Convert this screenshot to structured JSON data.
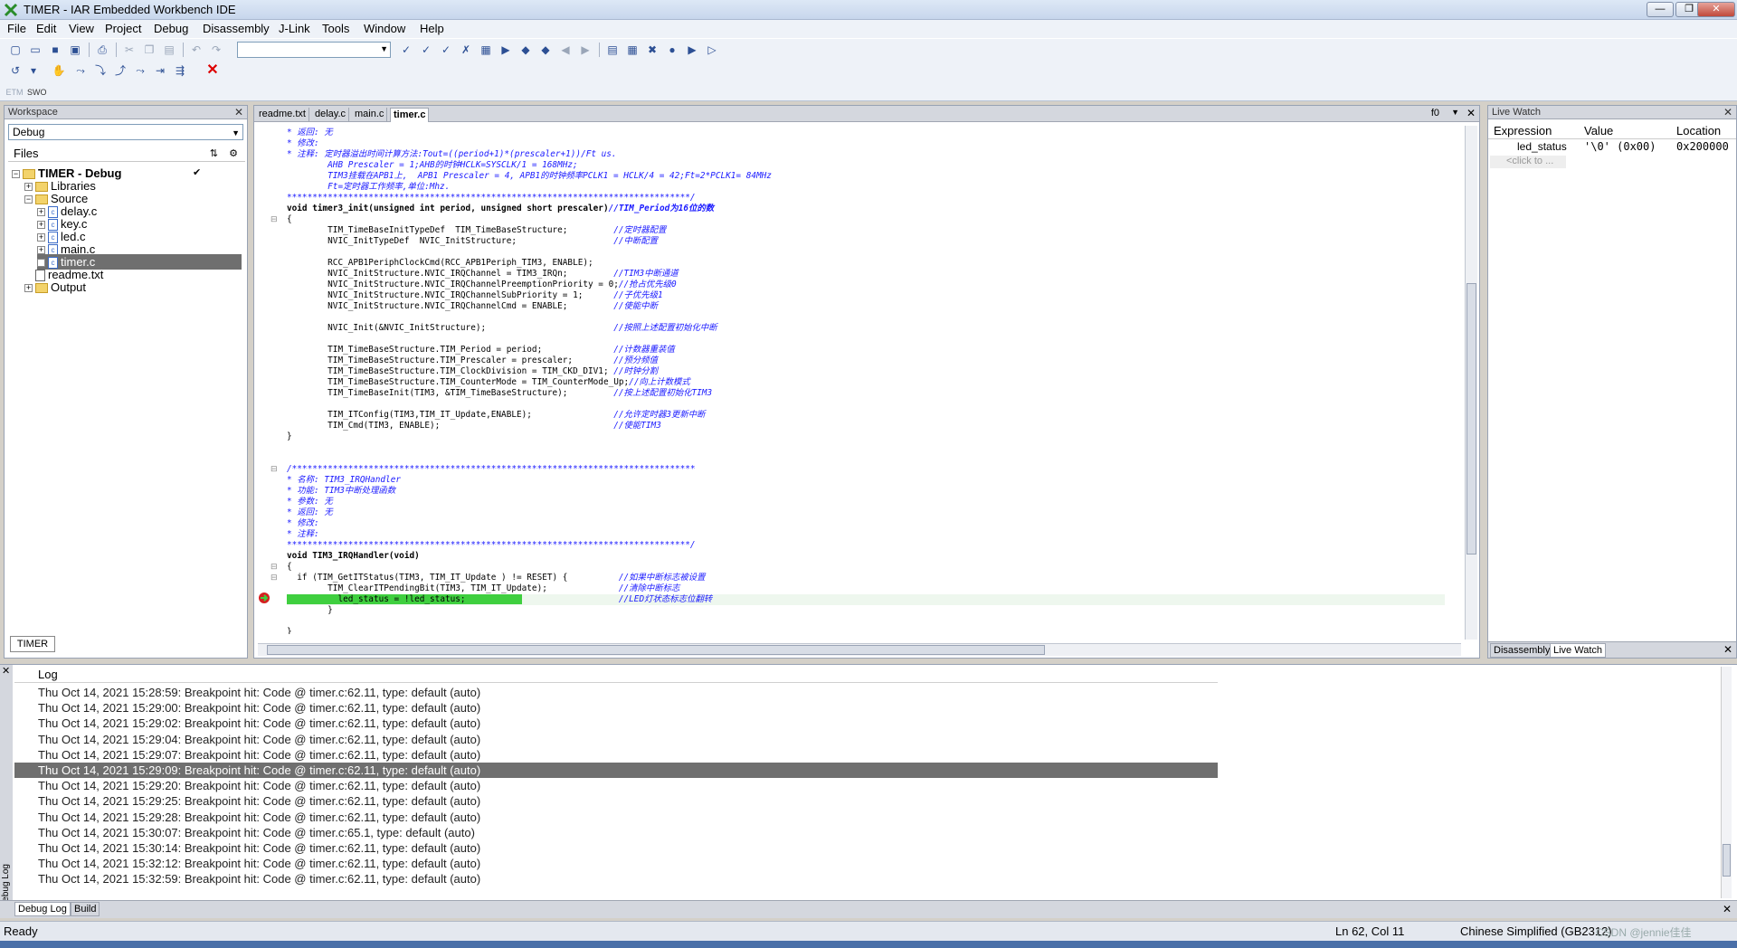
{
  "window": {
    "title": "TIMER - IAR Embedded Workbench IDE",
    "buttons": [
      "—",
      "❐",
      "✕"
    ]
  },
  "menu": [
    "File",
    "Edit",
    "View",
    "Project",
    "Debug",
    "Disassembly",
    "J-Link",
    "Tools",
    "Window",
    "Help"
  ],
  "toolbar3": {
    "etm_label": "ETM",
    "swo_label": "SWO"
  },
  "workspace": {
    "title": "Workspace",
    "config": "Debug",
    "files_header": "Files",
    "tree": [
      {
        "label": "TIMER - Debug",
        "level": 0,
        "type": "project",
        "expander": "−",
        "check": "✔"
      },
      {
        "label": "Libraries",
        "level": 1,
        "type": "folder",
        "expander": "+"
      },
      {
        "label": "Source",
        "level": 1,
        "type": "folder",
        "expander": "−"
      },
      {
        "label": "delay.c",
        "level": 2,
        "type": "c",
        "expander": "+"
      },
      {
        "label": "key.c",
        "level": 2,
        "type": "c",
        "expander": "+"
      },
      {
        "label": "led.c",
        "level": 2,
        "type": "c",
        "expander": "+"
      },
      {
        "label": "main.c",
        "level": 2,
        "type": "c",
        "expander": "+"
      },
      {
        "label": "timer.c",
        "level": 2,
        "type": "c",
        "expander": "+",
        "selected": true
      },
      {
        "label": "readme.txt",
        "level": 1,
        "type": "txt",
        "expander": ""
      },
      {
        "label": "Output",
        "level": 1,
        "type": "folder",
        "expander": "+"
      }
    ],
    "bottom_tab": "TIMER"
  },
  "editor": {
    "tabs": [
      "readme.txt",
      "delay.c",
      "main.c",
      "timer.c"
    ],
    "active_tab": "timer.c",
    "function_label": "f0",
    "lines": [
      {
        "t": "* 返回: 无",
        "c": "cm"
      },
      {
        "t": "* 修改:",
        "c": "cm"
      },
      {
        "t": "* 注释: 定时器溢出时间计算方法:Tout=((period+1)*(prescaler+1))/Ft us.",
        "c": "cm"
      },
      {
        "t": "        AHB Prescaler = 1;AHB的时钟HCLK=SYSCLK/1 = 168MHz;",
        "c": "cm"
      },
      {
        "t": "        TIM3挂载在APB1上,  APB1 Prescaler = 4, APB1的时钟频率PCLK1 = HCLK/4 = 42;Ft=2*PCLK1= 84MHz",
        "c": "cm"
      },
      {
        "t": "        Ft=定时器工作频率,单位:Mhz.",
        "c": "cm"
      },
      {
        "t": "*******************************************************************************/",
        "c": "cm"
      },
      {
        "t": "void timer3_init(unsigned int period, unsigned short prescaler)//TIM_Period为16位的数",
        "c": "fn"
      },
      {
        "t": "{",
        "c": ""
      },
      {
        "t": "        TIM_TimeBaseInitTypeDef  TIM_TimeBaseStructure;         //定时器配置",
        "c": "mix"
      },
      {
        "t": "        NVIC_InitTypeDef  NVIC_InitStructure;                   //中断配置",
        "c": "mix"
      },
      {
        "t": "",
        "c": ""
      },
      {
        "t": "        RCC_APB1PeriphClockCmd(RCC_APB1Periph_TIM3, ENABLE);",
        "c": ""
      },
      {
        "t": "        NVIC_InitStructure.NVIC_IRQChannel = TIM3_IRQn;         //TIM3中断通道",
        "c": "mix"
      },
      {
        "t": "        NVIC_InitStructure.NVIC_IRQChannelPreemptionPriority = 0;//抢占优先级0",
        "c": "mix"
      },
      {
        "t": "        NVIC_InitStructure.NVIC_IRQChannelSubPriority = 1;      //子优先级1",
        "c": "mix"
      },
      {
        "t": "        NVIC_InitStructure.NVIC_IRQChannelCmd = ENABLE;         //使能中断",
        "c": "mix"
      },
      {
        "t": "",
        "c": ""
      },
      {
        "t": "        NVIC_Init(&NVIC_InitStructure);                         //按照上述配置初始化中断",
        "c": "mix"
      },
      {
        "t": "",
        "c": ""
      },
      {
        "t": "        TIM_TimeBaseStructure.TIM_Period = period;              //计数器重装值",
        "c": "mix"
      },
      {
        "t": "        TIM_TimeBaseStructure.TIM_Prescaler = prescaler;        //预分频值",
        "c": "mix"
      },
      {
        "t": "        TIM_TimeBaseStructure.TIM_ClockDivision = TIM_CKD_DIV1; //时钟分割",
        "c": "mix"
      },
      {
        "t": "        TIM_TimeBaseStructure.TIM_CounterMode = TIM_CounterMode_Up;//向上计数模式",
        "c": "mix"
      },
      {
        "t": "        TIM_TimeBaseInit(TIM3, &TIM_TimeBaseStructure);         //按上述配置初始化TIM3",
        "c": "mix"
      },
      {
        "t": "",
        "c": ""
      },
      {
        "t": "        TIM_ITConfig(TIM3,TIM_IT_Update,ENABLE);                //允许定时器3更新中断",
        "c": "mix"
      },
      {
        "t": "        TIM_Cmd(TIM3, ENABLE);                                  //使能TIM3",
        "c": "mix"
      },
      {
        "t": "}",
        "c": ""
      },
      {
        "t": "",
        "c": ""
      },
      {
        "t": "",
        "c": ""
      },
      {
        "t": "/*******************************************************************************",
        "c": "cm"
      },
      {
        "t": "* 名称: TIM3_IRQHandler",
        "c": "cm"
      },
      {
        "t": "* 功能: TIM3中断处理函数",
        "c": "cm"
      },
      {
        "t": "* 参数: 无",
        "c": "cm"
      },
      {
        "t": "* 返回: 无",
        "c": "cm"
      },
      {
        "t": "* 修改:",
        "c": "cm"
      },
      {
        "t": "* 注释:",
        "c": "cm"
      },
      {
        "t": "*******************************************************************************/",
        "c": "cm"
      },
      {
        "t": "void TIM3_IRQHandler(void)",
        "c": "fn"
      },
      {
        "t": "{",
        "c": ""
      },
      {
        "t": "  if (TIM_GetITStatus(TIM3, TIM_IT_Update ) != RESET) {          //如果中断标志被设置",
        "c": "mix"
      },
      {
        "t": "        TIM_ClearITPendingBit(TIM3, TIM_IT_Update);              //清除中断标志",
        "c": "mix"
      },
      {
        "t": "          led_status = !led_status;                              //LED灯状态标志位翻转",
        "c": "hl"
      },
      {
        "t": "        }",
        "c": ""
      },
      {
        "t": "",
        "c": ""
      },
      {
        "t": "}",
        "c": ""
      }
    ]
  },
  "live_watch": {
    "title": "Live Watch",
    "columns": [
      "Expression",
      "Value",
      "Location"
    ],
    "rows": [
      {
        "expression": "led_status",
        "value": "'\\0' (0x00)",
        "location": "0x200000"
      }
    ],
    "placeholder": "<click to ...",
    "bottom_tabs": [
      "Disassembly",
      "Live Watch"
    ]
  },
  "log": {
    "header": "Log",
    "side_label": "Debug Log",
    "rows": [
      "Thu Oct 14, 2021 15:28:59: Breakpoint hit: Code @ timer.c:62.11, type: default (auto)",
      "Thu Oct 14, 2021 15:29:00: Breakpoint hit: Code @ timer.c:62.11, type: default (auto)",
      "Thu Oct 14, 2021 15:29:02: Breakpoint hit: Code @ timer.c:62.11, type: default (auto)",
      "Thu Oct 14, 2021 15:29:04: Breakpoint hit: Code @ timer.c:62.11, type: default (auto)",
      "Thu Oct 14, 2021 15:29:07: Breakpoint hit: Code @ timer.c:62.11, type: default (auto)",
      "Thu Oct 14, 2021 15:29:09: Breakpoint hit: Code @ timer.c:62.11, type: default (auto)",
      "Thu Oct 14, 2021 15:29:20: Breakpoint hit: Code @ timer.c:62.11, type: default (auto)",
      "Thu Oct 14, 2021 15:29:25: Breakpoint hit: Code @ timer.c:62.11, type: default (auto)",
      "Thu Oct 14, 2021 15:29:28: Breakpoint hit: Code @ timer.c:62.11, type: default (auto)",
      "Thu Oct 14, 2021 15:30:07: Breakpoint hit: Code @ timer.c:65.1, type: default (auto)",
      "Thu Oct 14, 2021 15:30:14: Breakpoint hit: Code @ timer.c:62.11, type: default (auto)",
      "Thu Oct 14, 2021 15:32:12: Breakpoint hit: Code @ timer.c:62.11, type: default (auto)",
      "Thu Oct 14, 2021 15:32:59: Breakpoint hit: Code @ timer.c:62.11, type: default (auto)"
    ],
    "selected_index": 5,
    "tabs": [
      "Debug Log",
      "Build"
    ]
  },
  "status": {
    "left": "Ready",
    "position": "Ln 62, Col 11",
    "encoding": "Chinese Simplified (GB2312)",
    "watermark": "CSDN @jennie佳佳"
  },
  "colors": {
    "comment": "#1a1aff",
    "exec_highlight": "#3fcf3f",
    "selected_log": "#6f6f6f"
  }
}
